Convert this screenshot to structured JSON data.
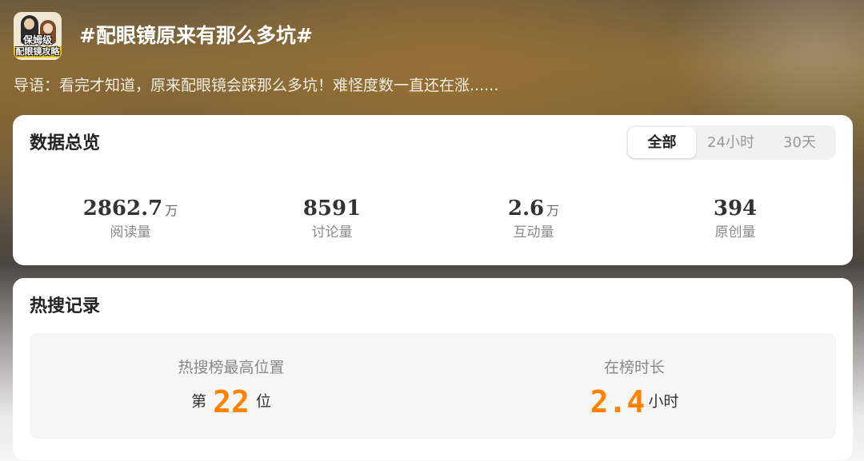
{
  "header": {
    "avatar": {
      "badge_line_1": "保姆级",
      "badge_line_2": "配眼镜攻略"
    },
    "title": "#配眼镜原来有那么多坑#"
  },
  "intro": "导语：看完才知道，原来配眼镜会踩那么多坑！难怪度数一直还在涨......",
  "overview": {
    "title": "数据总览",
    "tabs": [
      {
        "label": "全部",
        "active": true
      },
      {
        "label": "24小时",
        "active": false
      },
      {
        "label": "30天",
        "active": false
      }
    ],
    "stats": [
      {
        "value": "2862.7",
        "unit": "万",
        "label": "阅读量"
      },
      {
        "value": "8591",
        "unit": "",
        "label": "讨论量"
      },
      {
        "value": "2.6",
        "unit": "万",
        "label": "互动量"
      },
      {
        "value": "394",
        "unit": "",
        "label": "原创量"
      }
    ]
  },
  "hot_record": {
    "title": "热搜记录",
    "highest_position": {
      "label": "热搜榜最高位置",
      "prefix": "第",
      "value": "22",
      "suffix": "位"
    },
    "duration": {
      "label": "在榜时长",
      "value": "2.4",
      "suffix": "小时"
    }
  },
  "colors": {
    "accent_orange": "#ff8200",
    "card_bg": "#ffffff",
    "tab_bg": "#f1f1f1"
  }
}
